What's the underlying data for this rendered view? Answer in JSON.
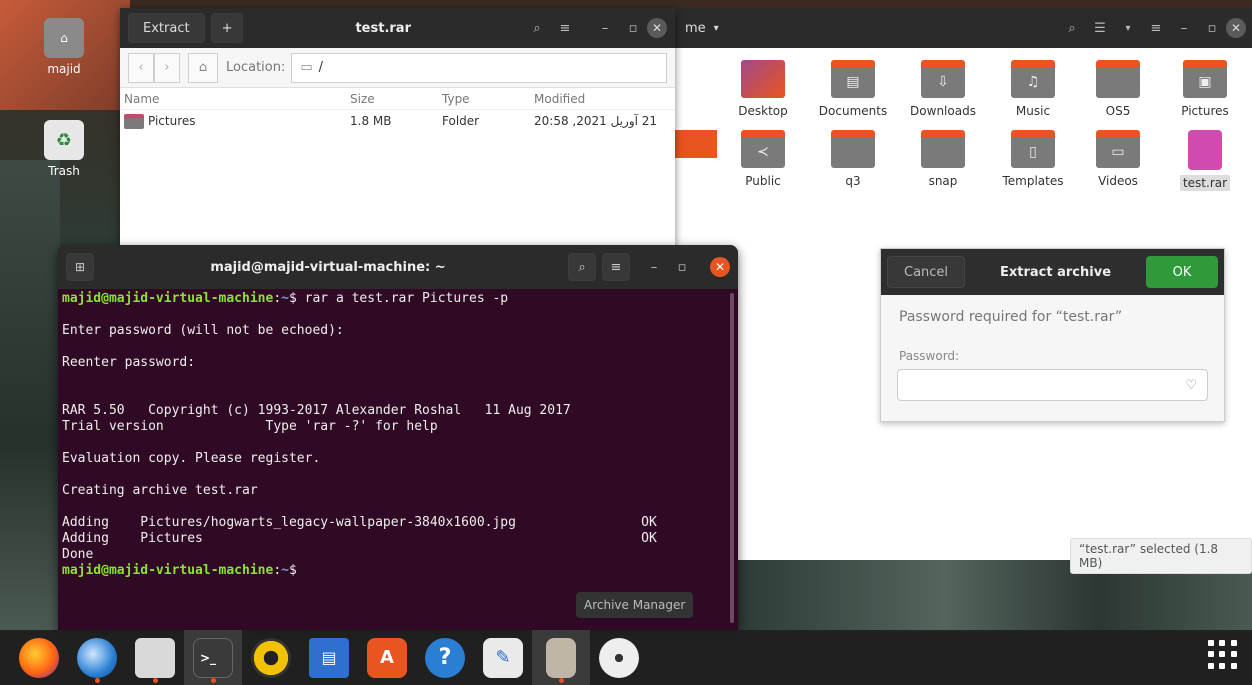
{
  "desktop": {
    "home_label": "majid",
    "trash_label": "Trash"
  },
  "archive": {
    "extract_label": "Extract",
    "add_label": "+",
    "title": "test.rar",
    "location_label": "Location:",
    "location_value": "/",
    "columns": [
      "Name",
      "Size",
      "Type",
      "Modified"
    ],
    "rows": [
      {
        "name": "Pictures",
        "size": "1.8 MB",
        "type": "Folder",
        "modified": "21 آوریل 2021, 20:58"
      }
    ]
  },
  "files": {
    "title_fragment": "me",
    "items": [
      {
        "label": "Desktop"
      },
      {
        "label": "Documents"
      },
      {
        "label": "Downloads"
      },
      {
        "label": "Music"
      },
      {
        "label": "OS5"
      },
      {
        "label": "Pictures"
      },
      {
        "label": "Public"
      },
      {
        "label": "q3"
      },
      {
        "label": "snap"
      },
      {
        "label": "Templates"
      },
      {
        "label": "Videos"
      },
      {
        "label": "test.rar"
      }
    ],
    "status": "“test.rar” selected (1.8 MB)"
  },
  "dialog": {
    "cancel_label": "Cancel",
    "title": "Extract archive",
    "ok_label": "OK",
    "required_text": "Password required for “test.rar”",
    "password_label": "Password:",
    "password_value": ""
  },
  "terminal": {
    "title": "majid@majid-virtual-machine: ~",
    "prompt_user": "majid@majid-virtual-machine",
    "prompt_path": "~",
    "command": "rar a test.rar Pictures -p",
    "lines": [
      "",
      "Enter password (will not be echoed):",
      "",
      "Reenter password:",
      "",
      "",
      "RAR 5.50   Copyright (c) 1993-2017 Alexander Roshal   11 Aug 2017",
      "Trial version             Type 'rar -?' for help",
      "",
      "Evaluation copy. Please register.",
      "",
      "Creating archive test.rar",
      "",
      "Adding    Pictures/hogwarts_legacy-wallpaper-3840x1600.jpg                OK",
      "Adding    Pictures                                                        OK",
      "Done"
    ],
    "tooltip": "Archive Manager"
  },
  "dock": {
    "apps": [
      "firefox",
      "thunderbird",
      "files",
      "terminal",
      "rhythmbox",
      "writer",
      "software",
      "help",
      "text-editor",
      "archive-manager",
      "dvd"
    ]
  }
}
